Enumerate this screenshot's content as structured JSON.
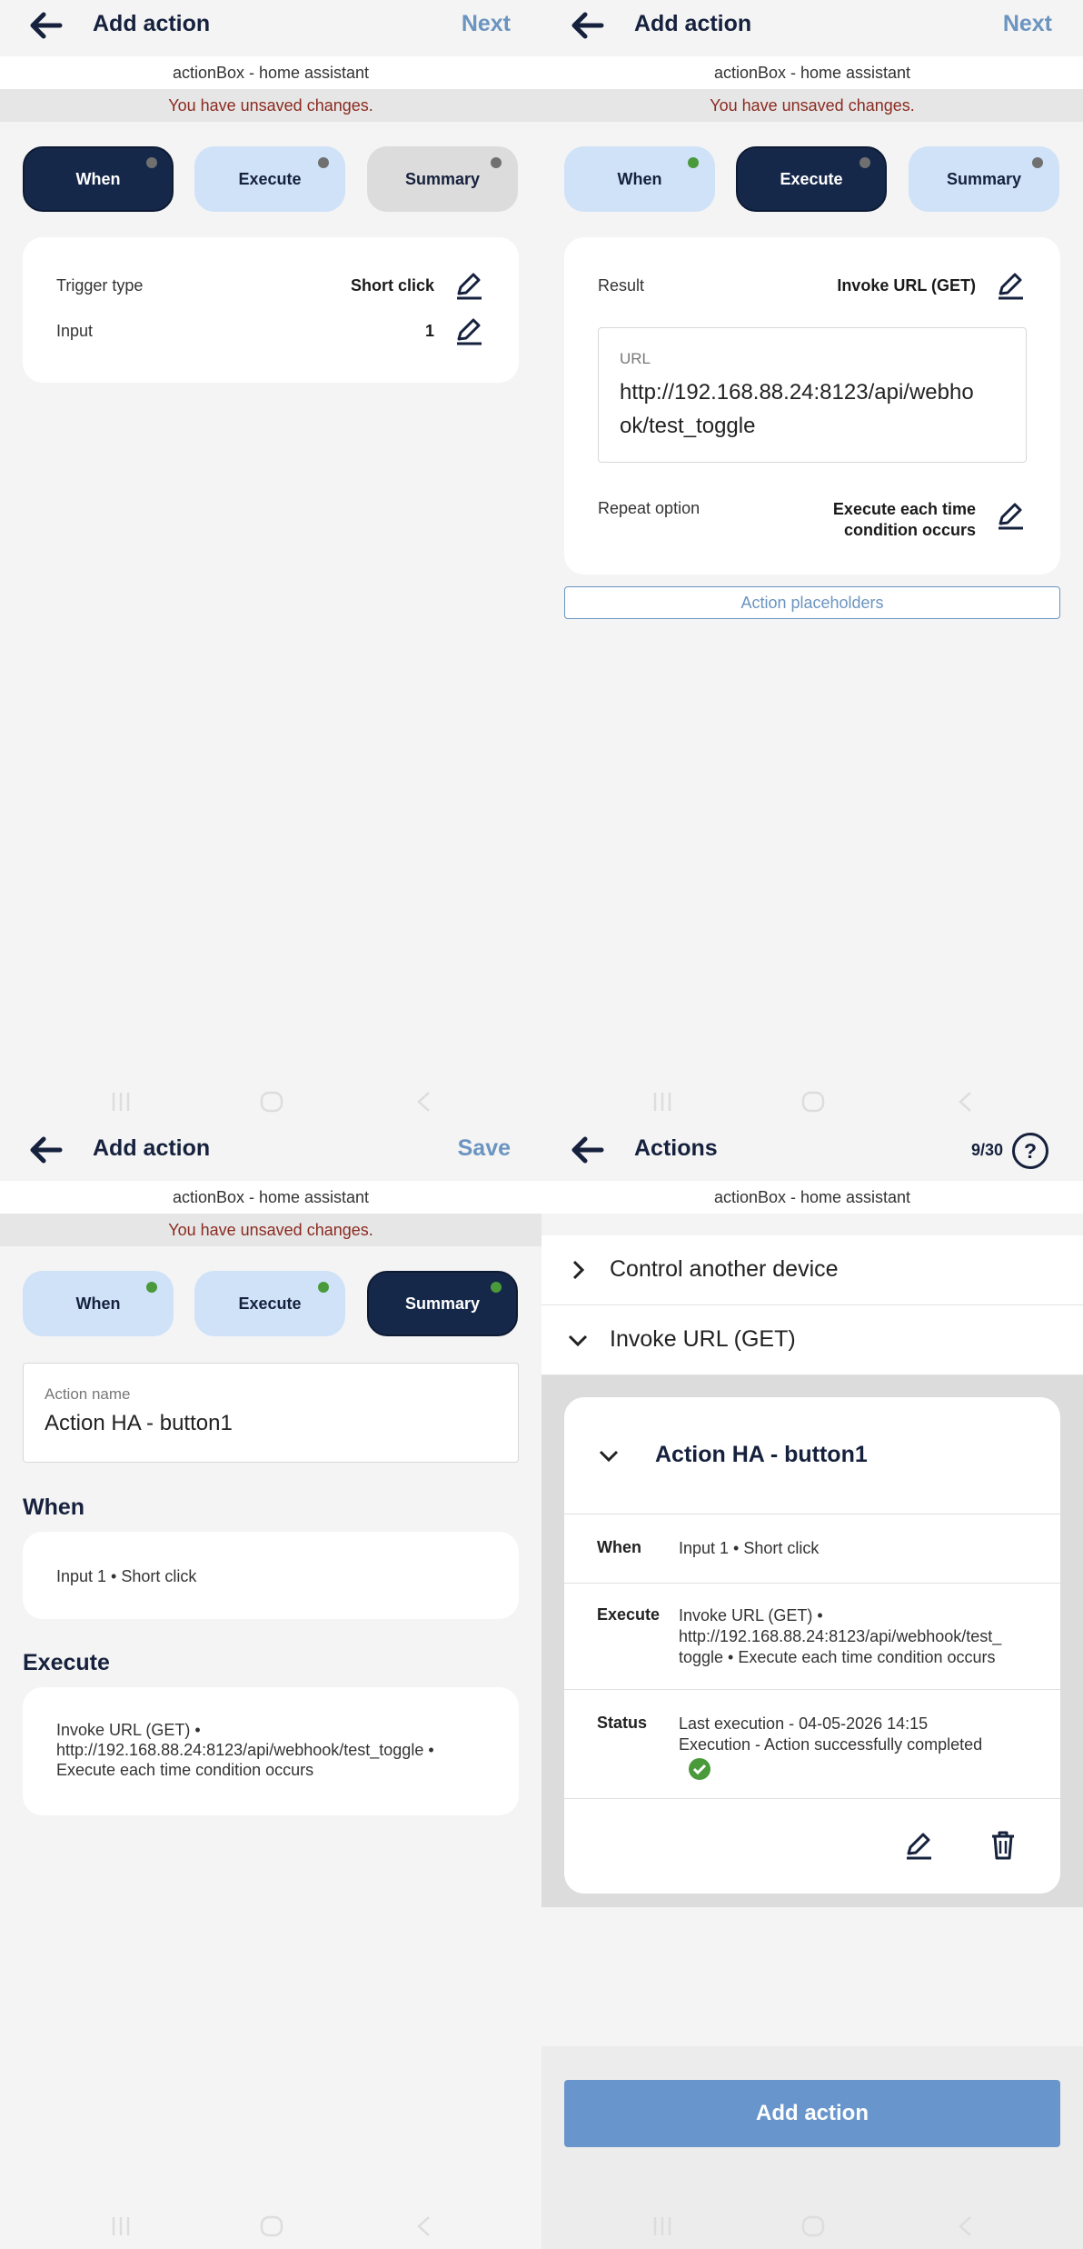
{
  "panel1": {
    "title": "Add action",
    "next": "Next",
    "subtitle": "actionBox - home assistant",
    "unsaved": "You have unsaved changes.",
    "tabs": [
      "When",
      "Execute",
      "Summary"
    ],
    "rows": [
      {
        "label": "Trigger type",
        "value": "Short click"
      },
      {
        "label": "Input",
        "value": "1"
      }
    ]
  },
  "panel2": {
    "title": "Add action",
    "next": "Next",
    "subtitle": "actionBox - home assistant",
    "unsaved": "You have unsaved changes.",
    "tabs": [
      "When",
      "Execute",
      "Summary"
    ],
    "result_label": "Result",
    "result_value": "Invoke URL (GET)",
    "url_label": "URL",
    "url_value_line1": "http://192.168.88.24:8123/api/webho",
    "url_value_line2": "ok/test_toggle",
    "repeat_label": "Repeat option",
    "repeat_value_line1": "Execute each time",
    "repeat_value_line2": "condition occurs",
    "placeholders": "Action placeholders"
  },
  "panel3": {
    "title": "Add action",
    "save": "Save",
    "subtitle": "actionBox - home assistant",
    "unsaved": "You have unsaved changes.",
    "tabs": [
      "When",
      "Execute",
      "Summary"
    ],
    "name_label": "Action name",
    "name_value": "Action HA - button1",
    "when_heading": "When",
    "when_text": "Input 1 • Short click",
    "execute_heading": "Execute",
    "execute_line1": "Invoke URL (GET) •",
    "execute_line2": "http://192.168.88.24:8123/api/webhook/test_toggle •",
    "execute_line3": "Execute each time condition occurs"
  },
  "panel4": {
    "title": "Actions",
    "counter": "9/30",
    "help": "?",
    "subtitle": "actionBox - home assistant",
    "list": [
      "Control another device",
      "Invoke URL (GET)"
    ],
    "card_title": "Action HA - button1",
    "when_label": "When",
    "when_value": "Input 1 • Short click",
    "execute_label": "Execute",
    "execute_line1": "Invoke URL (GET) •",
    "execute_line2": "http://192.168.88.24:8123/api/webhook/test_",
    "execute_line3": "toggle • Execute each time condition occurs",
    "status_label": "Status",
    "status_line1": "Last execution - 04-05-2026 14:15",
    "status_line2": "Execution - Action successfully completed",
    "add_action": "Add action"
  },
  "colors": {
    "active_tab": "#16284a",
    "inactive_tab": "#cfe2f8",
    "accent": "#6b94c0",
    "success": "#4a9a3c",
    "warning_text": "#8a2b20"
  }
}
